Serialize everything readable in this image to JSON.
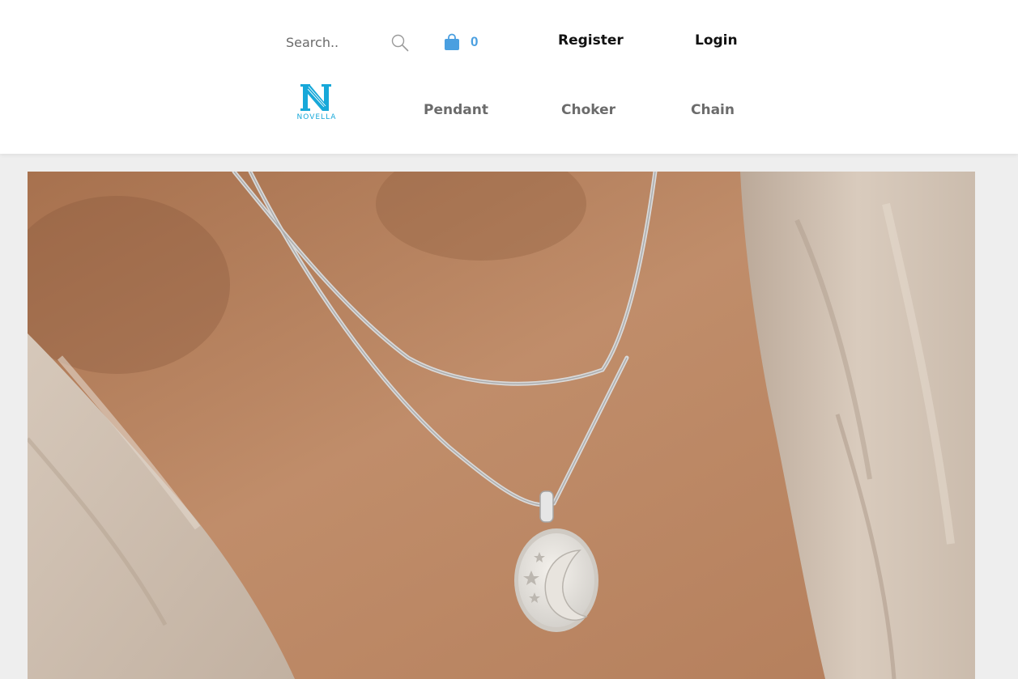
{
  "search": {
    "placeholder": "Search.."
  },
  "cart": {
    "count": "0",
    "color": "#4a9fe0"
  },
  "account": {
    "register_label": "Register",
    "login_label": "Login"
  },
  "logo": {
    "text": "NOVELLA",
    "color": "#17a8d9"
  },
  "nav": {
    "items": [
      {
        "label": "Pendant"
      },
      {
        "label": "Choker"
      },
      {
        "label": "Chain"
      }
    ]
  },
  "icons": {
    "search": "search-icon",
    "cart": "shopping-bag-icon",
    "logo": "novella-logo"
  },
  "colors": {
    "header_bg": "#ffffff",
    "page_bg": "#eeeeee",
    "nav_text": "#6b6b6b",
    "link_text": "#111111"
  }
}
